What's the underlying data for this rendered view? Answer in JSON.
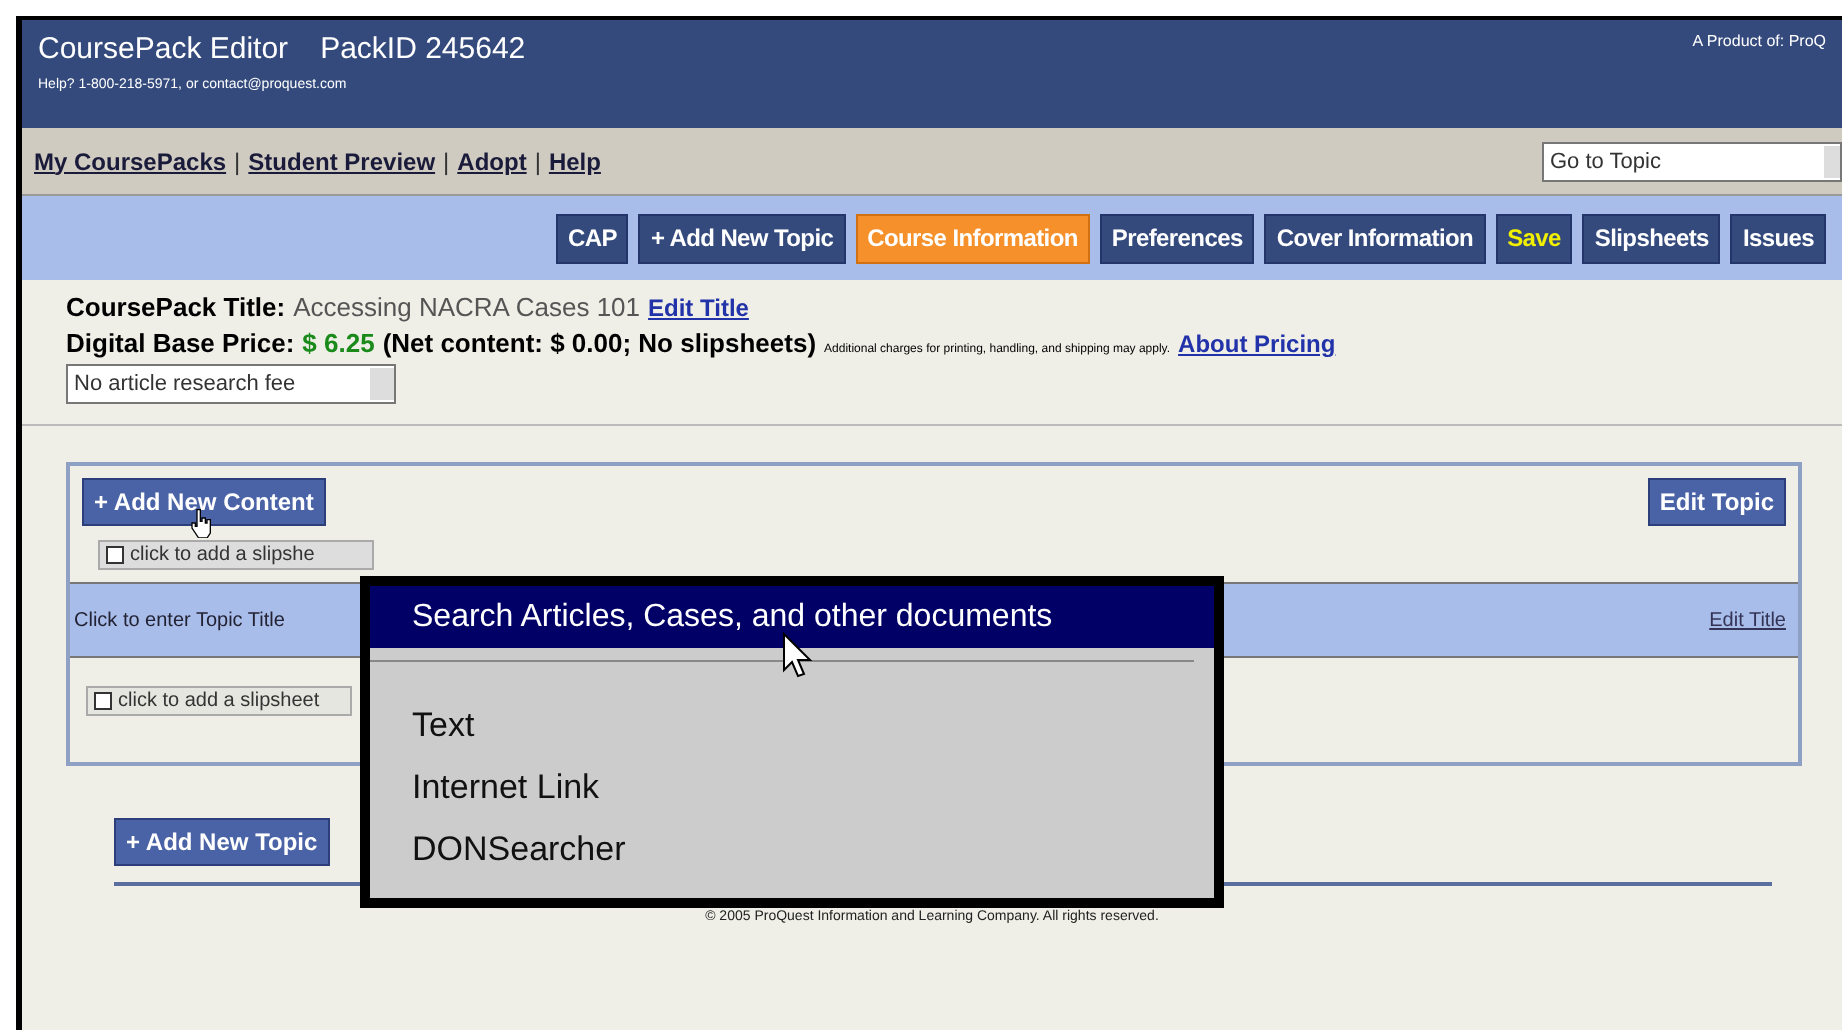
{
  "header": {
    "title": "CoursePack Editor",
    "pack_id": "PackID 245642",
    "help": "Help? 1-800-218-5971, or",
    "help_email": "contact@proquest.com",
    "product": "A Product of: ProQ"
  },
  "nav": {
    "links": [
      "My CoursePacks",
      "Student Preview",
      "Adopt",
      "Help"
    ],
    "separators": [
      "|",
      "|",
      "|"
    ],
    "goto": {
      "value": "Go to Topic"
    }
  },
  "toolbar": [
    {
      "label": "CAP",
      "kind": "normal",
      "selected": false
    },
    {
      "label": "+ Add New Topic",
      "kind": "normal",
      "selected": false
    },
    {
      "label": "Course Information",
      "kind": "normal",
      "selected": true
    },
    {
      "label": "Preferences",
      "kind": "normal",
      "selected": false
    },
    {
      "label": "Cover Information",
      "kind": "normal",
      "selected": false
    },
    {
      "label": "Save",
      "kind": "save",
      "selected": false
    },
    {
      "label": "Slipsheets",
      "kind": "normal",
      "selected": false
    },
    {
      "label": "Issues",
      "kind": "normal",
      "selected": false
    }
  ],
  "info": {
    "title_label": "CoursePack Title:",
    "title_value": "Accessing NACRA Cases 101",
    "edit_title": "Edit Title",
    "price_label": "Digital Base Price:",
    "price": "$ 6.25",
    "net": "(Net content: $ 0.00; No slipsheets)",
    "note": "Additional charges for printing, handling, and shipping may apply.",
    "about": "About Pricing",
    "fee_select": "No article research fee"
  },
  "topic": {
    "add_content": "+ Add New Content",
    "edit_topic": "Edit Topic",
    "slipsheet_hint": "click to add a slipshe",
    "title_placeholder": "Click to enter Topic Title",
    "edit_title": "Edit Title",
    "slipsheet": "click to add a slipsheet"
  },
  "add_topic": "+ Add New Topic",
  "footer": "© 2005 ProQuest Information and Learning Company. All rights reserved.",
  "menu": [
    {
      "label": "Search Articles, Cases, and other documents",
      "selected": true
    },
    {
      "label": "Text",
      "selected": false
    },
    {
      "label": "Internet Link",
      "selected": false
    },
    {
      "label": "DONSearcher",
      "selected": false
    }
  ]
}
